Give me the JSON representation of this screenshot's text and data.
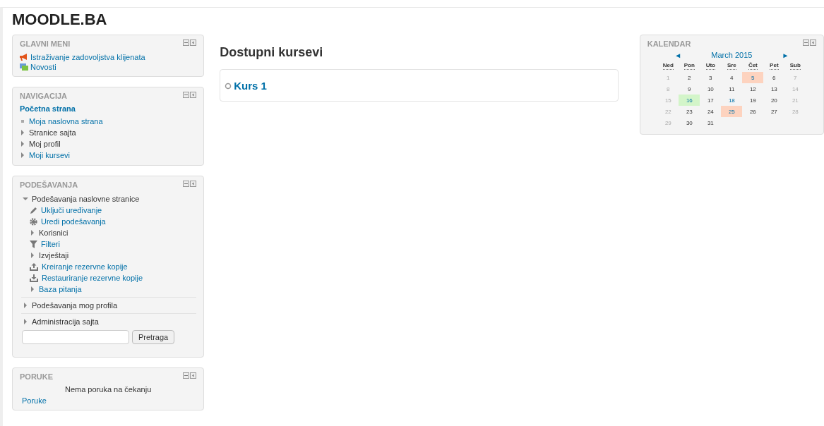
{
  "site_name": "MOODLE.BA",
  "main_menu": {
    "title": "GLAVNI MENI",
    "items": [
      {
        "label": "Istraživanje zadovoljstva klijenata",
        "kind": "megaphone"
      },
      {
        "label": "Novosti",
        "kind": "forum"
      }
    ]
  },
  "navigation": {
    "title": "NAVIGACIJA",
    "home": "Početna strana",
    "items": [
      {
        "label": "Moja naslovna strana",
        "kind": "leaf",
        "link": true
      },
      {
        "label": "Stranice sajta",
        "kind": "branch",
        "link": false
      },
      {
        "label": "Moj profil",
        "kind": "branch",
        "link": false
      },
      {
        "label": "Moji kursevi",
        "kind": "branch",
        "link": true
      }
    ]
  },
  "settings": {
    "title": "PODEŠAVANJA",
    "items": [
      {
        "label": "Podešavanja naslovne stranice",
        "kind": "branch",
        "link": false,
        "expanded": true,
        "children": [
          {
            "label": "Uključi uređivanje",
            "kind": "pencil",
            "link": true
          },
          {
            "label": "Uredi podešavanja",
            "kind": "gear",
            "link": true
          },
          {
            "label": "Korisnici",
            "kind": "branch",
            "link": false,
            "expanded": false
          },
          {
            "label": "Filteri",
            "kind": "filter",
            "link": true
          },
          {
            "label": "Izvještaji",
            "kind": "branch",
            "link": false,
            "expanded": false
          },
          {
            "label": "Kreiranje rezervne kopije",
            "kind": "upload",
            "link": true
          },
          {
            "label": "Restauriranje rezervne kopije",
            "kind": "download",
            "link": true
          },
          {
            "label": "Baza pitanja",
            "kind": "branch",
            "link": true,
            "expanded": false
          }
        ]
      },
      {
        "label": "Podešavanja mog profila",
        "kind": "branch",
        "link": false,
        "expanded": false
      },
      {
        "label": "Administracija sajta",
        "kind": "branch",
        "link": false,
        "expanded": false
      }
    ],
    "search_button": "Pretraga"
  },
  "messages": {
    "title": "PORUKE",
    "text": "Nema poruka na čekanju",
    "link": "Poruke"
  },
  "main": {
    "heading": "Dostupni kursevi",
    "courses": [
      "Kurs 1"
    ]
  },
  "calendar": {
    "title": "KALENDAR",
    "prev": "◄",
    "month": "March 2015",
    "next": "►",
    "weekdays": [
      "Ned",
      "Pon",
      "Uto",
      "Sre",
      "Čet",
      "Pet",
      "Sub"
    ],
    "weeks": [
      [
        {
          "label": "1",
          "kind": "weekend"
        },
        {
          "label": "2",
          "kind": "normal"
        },
        {
          "label": "3",
          "kind": "normal"
        },
        {
          "label": "4",
          "kind": "normal"
        },
        {
          "label": "5",
          "kind": "event"
        },
        {
          "label": "6",
          "kind": "normal"
        },
        {
          "label": "7",
          "kind": "weekend"
        }
      ],
      [
        {
          "label": "8",
          "kind": "weekend"
        },
        {
          "label": "9",
          "kind": "normal"
        },
        {
          "label": "10",
          "kind": "normal"
        },
        {
          "label": "11",
          "kind": "normal"
        },
        {
          "label": "12",
          "kind": "normal"
        },
        {
          "label": "13",
          "kind": "normal"
        },
        {
          "label": "14",
          "kind": "weekend"
        }
      ],
      [
        {
          "label": "15",
          "kind": "weekend"
        },
        {
          "label": "16",
          "kind": "today"
        },
        {
          "label": "17",
          "kind": "normal"
        },
        {
          "label": "18",
          "kind": "link"
        },
        {
          "label": "19",
          "kind": "normal"
        },
        {
          "label": "20",
          "kind": "normal"
        },
        {
          "label": "21",
          "kind": "weekend"
        }
      ],
      [
        {
          "label": "22",
          "kind": "weekend"
        },
        {
          "label": "23",
          "kind": "normal"
        },
        {
          "label": "24",
          "kind": "normal"
        },
        {
          "label": "25",
          "kind": "event"
        },
        {
          "label": "26",
          "kind": "normal"
        },
        {
          "label": "27",
          "kind": "normal"
        },
        {
          "label": "28",
          "kind": "weekend"
        }
      ],
      [
        {
          "label": "29",
          "kind": "weekend"
        },
        {
          "label": "30",
          "kind": "normal"
        },
        {
          "label": "31",
          "kind": "normal"
        }
      ]
    ]
  }
}
